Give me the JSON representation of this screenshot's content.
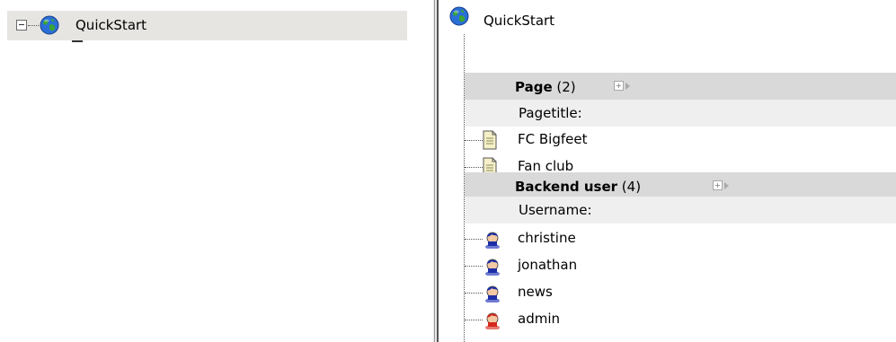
{
  "left_tree": {
    "root_label": "QuickStart",
    "root_icon": "globe-icon",
    "toggle_icon": "collapse-minus-icon"
  },
  "right_panel": {
    "root_label": "QuickStart",
    "root_icon": "globe-icon",
    "sections": [
      {
        "title": "Page",
        "count": "(2)",
        "column_label": "Pagetitle:",
        "item_icon": "page-document-icon",
        "items": [
          "FC Bigfeet",
          "Fan club"
        ]
      },
      {
        "title": "Backend user",
        "count": "(4)",
        "column_label": "Username:",
        "items": [
          {
            "label": "christine",
            "icon": "user-icon",
            "color": "#1d2ea8"
          },
          {
            "label": "jonathan",
            "icon": "user-icon",
            "color": "#1d2ea8"
          },
          {
            "label": "news",
            "icon": "user-icon",
            "color": "#1d2ea8"
          },
          {
            "label": "admin",
            "icon": "admin-user-icon",
            "color": "#d4281c"
          }
        ]
      }
    ]
  },
  "colors": {
    "row_highlight": "#e6e5e2",
    "section_header_bg": "#d9d9d9",
    "column_label_bg": "#efefef",
    "user_blue": "#1d2ea8",
    "admin_red": "#d4281c"
  }
}
